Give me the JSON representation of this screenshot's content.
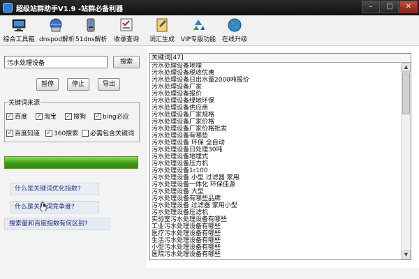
{
  "window": {
    "title": "超级站群助手V1.9 -站群必备利器"
  },
  "toolbar": {
    "items": [
      {
        "label": "综合工具箱",
        "icon": "computer-icon"
      },
      {
        "label": "dnspod解析",
        "icon": "globe-network-icon"
      },
      {
        "label": "51dns解析",
        "icon": "server-icon"
      },
      {
        "label": "收录查询",
        "icon": "checklist-icon"
      },
      {
        "label": "词汇生成",
        "icon": "notepad-icon"
      },
      {
        "label": "VIP专版功能",
        "icon": "recycle-icon"
      },
      {
        "label": "在线升级",
        "icon": "earth-icon"
      }
    ]
  },
  "search": {
    "value": "污水处理设备",
    "button": "搜索"
  },
  "actions": {
    "pause": "暂停",
    "stop": "停止",
    "export": "导出"
  },
  "sources": {
    "title": "关键词来源",
    "options": [
      {
        "label": "百度",
        "checked": true
      },
      {
        "label": "淘宝",
        "checked": true
      },
      {
        "label": "搜狗",
        "checked": true
      },
      {
        "label": "bing必应",
        "checked": true
      },
      {
        "label": "百度知道",
        "checked": true
      },
      {
        "label": "360搜索",
        "checked": true
      },
      {
        "label": "必需包含关键词",
        "checked": false
      }
    ]
  },
  "progress": {
    "value": 1.0
  },
  "links": {
    "q1": "什么是关键词优化指数?",
    "q2": "什么是关键词竞争度?",
    "q3": "搜索量和百度指数有何区别?"
  },
  "keywords": {
    "header": "关键词[47]",
    "items": [
      "污水处理设备地埋",
      "污水处理设备税收优惠",
      "污水处理设备日出水量2000吨报价",
      "污水处理设备厂家",
      "污水处理设备报价",
      "污水处理设备绿地环保",
      "污水处理设备供应商",
      "污水处理设备厂家规格",
      "污水处理设备厂家价格",
      "污水处理设备厂家价格批发",
      "污水处理设备有哪些",
      "污水处理设备 环保 全自动",
      "污水处理设备日处理30吨",
      "污水处理设备地埋式",
      "污水处理设备压力机",
      "污水处理设备1r100",
      "污水处理设备 小型 过滤器 家用",
      "污水处理设备一体化 环保佳源",
      "污水处理设备 大型",
      "污水处理设备有哪些品牌",
      "污水处理设备 过滤器 家用小型",
      "污水处理设备压滤机",
      "实验室污水处理设备有哪些",
      "工业污水处理设备有哪些",
      "医疗污水处理设备有哪些",
      "生活污水处理设备有哪些",
      "小型污水处理设备有哪些",
      "医院污水处理设备有哪些"
    ]
  },
  "colors": {
    "titlebar": "#1a1a1a",
    "progress": "#3f9a17",
    "link_text": "#1c2e7a"
  }
}
